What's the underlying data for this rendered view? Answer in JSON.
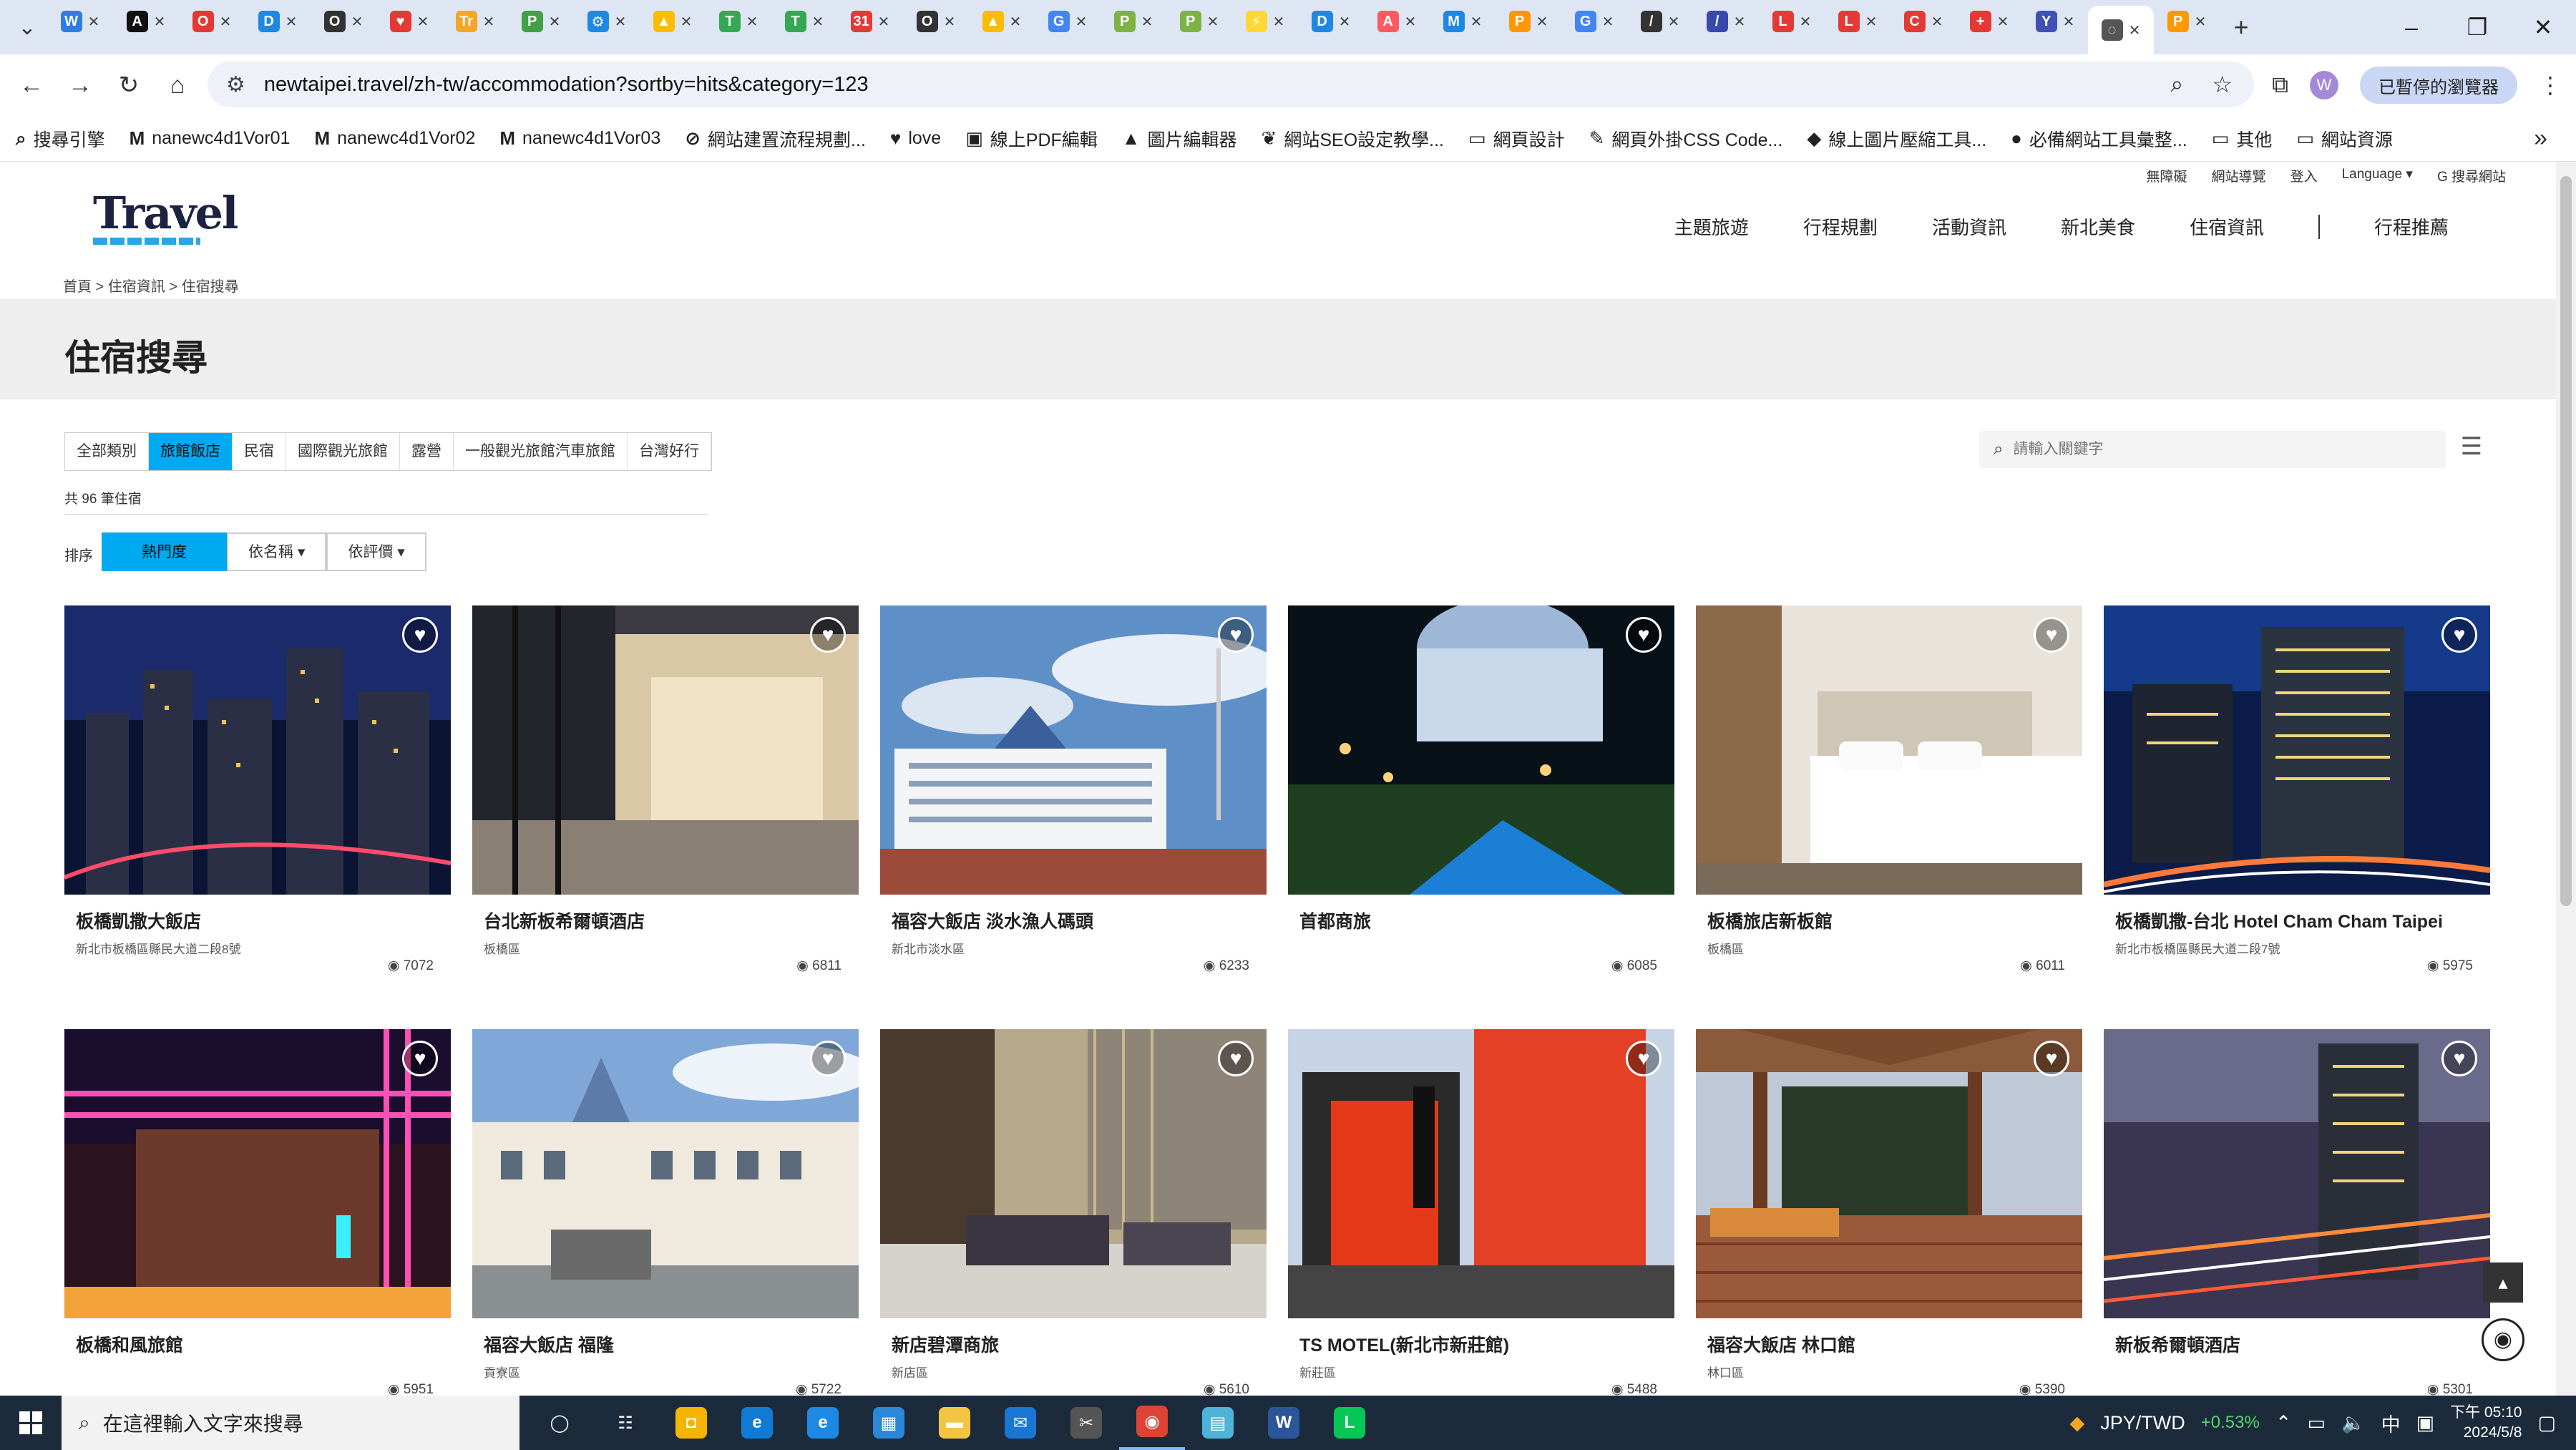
{
  "browser": {
    "tabs": [
      {
        "icon": "grid-icon",
        "color": "#2f7de1",
        "letter": "W"
      },
      {
        "icon": "black-logo-icon",
        "color": "#111111",
        "letter": "A"
      },
      {
        "icon": "record-icon",
        "color": "#e53935",
        "letter": "O"
      },
      {
        "icon": "square-icon",
        "color": "#1e88e5",
        "letter": "D"
      },
      {
        "icon": "circle-icon",
        "color": "#333333",
        "letter": "O"
      },
      {
        "icon": "heart-icon",
        "color": "#e53935",
        "letter": "♥"
      },
      {
        "icon": "tr-icon",
        "color": "#f5a623",
        "letter": "Tr"
      },
      {
        "icon": "leaf-icon",
        "color": "#43a047",
        "letter": "P"
      },
      {
        "icon": "gear-icon",
        "color": "#1e88e5",
        "letter": "⚙"
      },
      {
        "icon": "drive-icon",
        "color": "#fbbc04",
        "letter": "▲"
      },
      {
        "icon": "sheet-icon",
        "color": "#34a853",
        "letter": "T"
      },
      {
        "icon": "sheet-icon",
        "color": "#34a853",
        "letter": "T"
      },
      {
        "icon": "calendar-icon",
        "color": "#e53935",
        "letter": "31"
      },
      {
        "icon": "circle-icon",
        "color": "#333333",
        "letter": "O"
      },
      {
        "icon": "drive-icon",
        "color": "#fbbc04",
        "letter": "▲"
      },
      {
        "icon": "google-icon",
        "color": "#4285f4",
        "letter": "G"
      },
      {
        "icon": "leaf-icon",
        "color": "#7cb342",
        "letter": "P"
      },
      {
        "icon": "leaf-icon",
        "color": "#7cb342",
        "letter": "P"
      },
      {
        "icon": "bolt-icon",
        "color": "#fdd835",
        "letter": "⚡"
      },
      {
        "icon": "doc-icon",
        "color": "#1e88e5",
        "letter": "D"
      },
      {
        "icon": "airbnb-icon",
        "color": "#ff5a5f",
        "letter": "A"
      },
      {
        "icon": "map-icon",
        "color": "#1e88e5",
        "letter": "M"
      },
      {
        "icon": "panda-icon",
        "color": "#ff9800",
        "letter": "P"
      },
      {
        "icon": "google-icon",
        "color": "#4285f4",
        "letter": "G"
      },
      {
        "icon": "pen-icon",
        "color": "#333333",
        "letter": "/"
      },
      {
        "icon": "pen-icon",
        "color": "#3949ab",
        "letter": "/"
      },
      {
        "icon": "lips-icon",
        "color": "#e53935",
        "letter": "L"
      },
      {
        "icon": "lips-icon",
        "color": "#e53935",
        "letter": "L"
      },
      {
        "icon": "c-icon",
        "color": "#e53935",
        "letter": "C"
      },
      {
        "icon": "cross-icon",
        "color": "#e53935",
        "letter": "+"
      },
      {
        "icon": "tree-icon",
        "color": "#3f51b5",
        "letter": "Y"
      },
      {
        "icon": "loading-icon",
        "color": "#555555",
        "letter": "◌"
      },
      {
        "icon": "panda-icon",
        "color": "#ff9800",
        "letter": "P"
      }
    ],
    "active_tab_index": 31,
    "url": "newtaipei.travel/zh-tw/accommodation?sortby=hits&category=123",
    "profile_label": "已暫停的瀏覽器"
  },
  "bookmarks": [
    {
      "icon": "search-icon",
      "glyph": "⌕",
      "label": "搜尋引擎"
    },
    {
      "icon": "gmail-icon",
      "glyph": "M",
      "label": "nanewc4d1Vor01"
    },
    {
      "icon": "gmail-icon",
      "glyph": "M",
      "label": "nanewc4d1Vor02"
    },
    {
      "icon": "gmail-icon",
      "glyph": "M",
      "label": "nanewc4d1Vor03"
    },
    {
      "icon": "link-icon",
      "glyph": "⊘",
      "label": "網站建置流程規劃..."
    },
    {
      "icon": "heart-icon",
      "glyph": "♥",
      "label": "love"
    },
    {
      "icon": "pdf-icon",
      "glyph": "▣",
      "label": "線上PDF編輯"
    },
    {
      "icon": "black-logo-icon",
      "glyph": "▲",
      "label": "圖片編輯器"
    },
    {
      "icon": "leaf-icon",
      "glyph": "❦",
      "label": "網站SEO設定教學..."
    },
    {
      "icon": "folder-icon",
      "glyph": "▭",
      "label": "網頁設計"
    },
    {
      "icon": "wrench-icon",
      "glyph": "✎",
      "label": "網頁外掛CSS Code..."
    },
    {
      "icon": "gem-icon",
      "glyph": "◆",
      "label": "線上圖片壓縮工具..."
    },
    {
      "icon": "smile-icon",
      "glyph": "●",
      "label": "必備網站工具彙整..."
    },
    {
      "icon": "folder-icon",
      "glyph": "▭",
      "label": "其他"
    },
    {
      "icon": "folder-icon",
      "glyph": "▭",
      "label": "網站資源"
    }
  ],
  "site": {
    "logo_text": "Travel",
    "utility": [
      "無障礙",
      "網站導覽",
      "登入",
      "Language ▾",
      "G 搜尋網站"
    ],
    "nav": [
      "主題旅遊",
      "行程規劃",
      "活動資訊",
      "新北美食",
      "住宿資訊",
      "行程推薦"
    ],
    "breadcrumb": "首頁 > 住宿資訊 > 住宿搜尋",
    "page_title": "住宿搜尋",
    "categories": [
      "全部類別",
      "旅館飯店",
      "民宿",
      "國際觀光旅館",
      "露營",
      "一般觀光旅館汽車旅館",
      "台灣好行"
    ],
    "active_category": 1,
    "filter_caption": "共 96 筆住宿",
    "sort_label": "排序",
    "sort_buttons": [
      "熱門度",
      "依名稱 ▾",
      "依評價 ▾"
    ],
    "search_placeholder": "請輸入關鍵字"
  },
  "hotels": [
    {
      "name": "板橋凱撒大飯店",
      "meta": "新北市板橋區縣民大道二段8號",
      "views": "7072",
      "scene": "city-night"
    },
    {
      "name": "台北新板希爾頓酒店",
      "meta": "板橋區",
      "views": "6811",
      "scene": "lobby"
    },
    {
      "name": "福容大飯店 淡水漁人碼頭",
      "meta": "新北市淡水區",
      "views": "6233",
      "scene": "seaside"
    },
    {
      "name": "首都商旅",
      "meta": "",
      "views": "6085",
      "scene": "pool-night"
    },
    {
      "name": "板橋旅店新板館",
      "meta": "板橋區",
      "views": "6011",
      "scene": "bedroom"
    },
    {
      "name": "板橋凱撒-台北 Hotel Cham Cham Taipei",
      "meta": "新北市板橋區縣民大道二段7號",
      "views": "5975",
      "scene": "tower-night"
    },
    {
      "name": "板橋和風旅館",
      "meta": "",
      "views": "5951",
      "scene": "neon"
    },
    {
      "name": "福容大飯店 福隆",
      "meta": "貢寮區",
      "views": "5722",
      "scene": "white-hotel"
    },
    {
      "name": "新店碧潭商旅",
      "meta": "新店區",
      "views": "5610",
      "scene": "lounge"
    },
    {
      "name": "TS MOTEL(新北市新莊館)",
      "meta": "新莊區",
      "views": "5488",
      "scene": "red-motel"
    },
    {
      "name": "福容大飯店 林口館",
      "meta": "林口區",
      "views": "5390",
      "scene": "deck"
    },
    {
      "name": "新板希爾頓酒店",
      "meta": "",
      "views": "5301",
      "scene": "highway"
    }
  ],
  "taskbar": {
    "search_placeholder": "在這裡輸入文字來搜尋",
    "apps": [
      {
        "icon": "task-view-icon",
        "glyph": "◯",
        "color": "#1c2b3b"
      },
      {
        "icon": "widgets-icon",
        "glyph": "☷",
        "color": "#1c2b3b"
      },
      {
        "icon": "sticky-notes-icon",
        "glyph": "◘",
        "color": "#f4b400"
      },
      {
        "icon": "edge-icon",
        "glyph": "e",
        "color": "#0f7bd5"
      },
      {
        "icon": "ie-icon",
        "glyph": "e",
        "color": "#1e88e5"
      },
      {
        "icon": "store-icon",
        "glyph": "▦",
        "color": "#2b88d8"
      },
      {
        "icon": "explorer-icon",
        "glyph": "▬",
        "color": "#f4c542"
      },
      {
        "icon": "mail-icon",
        "glyph": "✉",
        "color": "#1976d2"
      },
      {
        "icon": "snip-icon",
        "glyph": "✂",
        "color": "#555555"
      },
      {
        "icon": "chrome-icon",
        "glyph": "◉",
        "color": "#db4437"
      },
      {
        "icon": "notepad-icon",
        "glyph": "▤",
        "color": "#4fb3d9"
      },
      {
        "icon": "word-icon",
        "glyph": "W",
        "color": "#2b579a"
      },
      {
        "icon": "line-icon",
        "glyph": "L",
        "color": "#06c755"
      }
    ],
    "active_app": 9,
    "fx_label": "JPY/TWD",
    "fx_change": "+0.53%",
    "ime": "中",
    "time": "下午 05:10",
    "date": "2024/5/8"
  }
}
